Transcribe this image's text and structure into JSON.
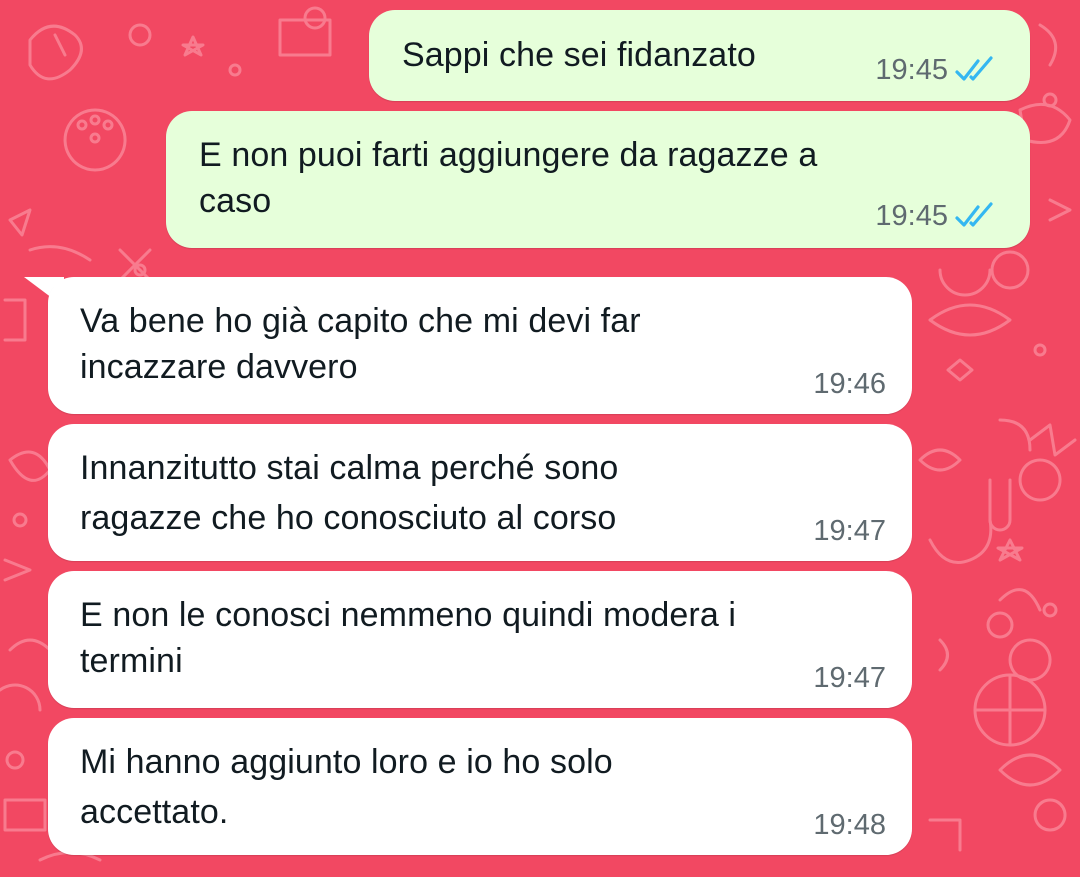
{
  "chat": {
    "colors": {
      "wallpaper": "#f24862",
      "outgoing_bubble": "#e6ffda",
      "incoming_bubble": "#ffffff",
      "read_ticks": "#34b7f1",
      "time_text": "#5f6a70",
      "message_text": "#111b21"
    },
    "messages": [
      {
        "direction": "outgoing",
        "text": "Sappi che sei fidanzato",
        "time": "19:45",
        "status_icon": "double-check-read-icon"
      },
      {
        "direction": "outgoing",
        "line1": "E non puoi farti aggiungere da ragazze a",
        "line2": "caso",
        "time": "19:45",
        "status_icon": "double-check-read-icon"
      },
      {
        "direction": "incoming",
        "line1": "Va bene ho già capito che mi devi far",
        "line2": "incazzare davvero",
        "time": "19:46"
      },
      {
        "direction": "incoming",
        "line1": "Innanzitutto stai calma perché sono",
        "line2": "ragazze che ho conosciuto al corso",
        "time": "19:47"
      },
      {
        "direction": "incoming",
        "line1": "E non le conosci nemmeno quindi modera i",
        "line2": "termini",
        "time": "19:47"
      },
      {
        "direction": "incoming",
        "line1": "Mi hanno aggiunto loro e io ho solo",
        "line2": "accettato.",
        "time": "19:48"
      }
    ]
  }
}
